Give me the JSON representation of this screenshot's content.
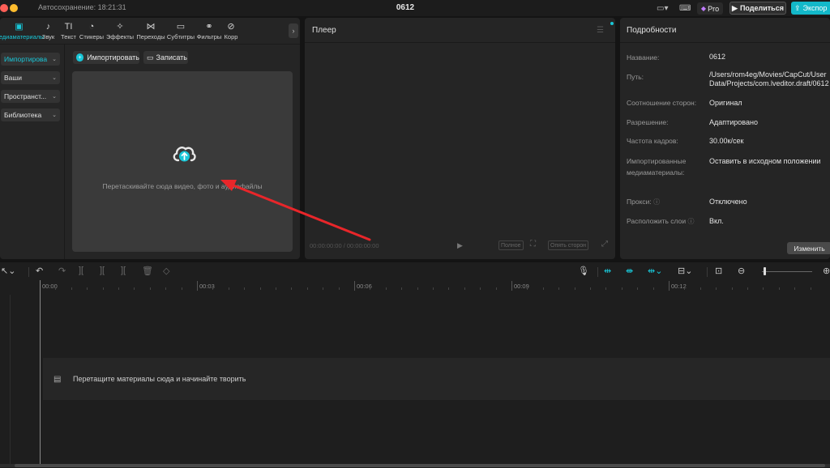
{
  "titlebar": {
    "autosave": "Автосохранение: 18:21:31",
    "project_title": "0612",
    "pro_label": "Pro",
    "share_label": "Поделиться",
    "export_label": "Экспор"
  },
  "media_tabs": [
    {
      "label": "Медиаматериалы",
      "icon": "media-icon",
      "glyph": "▣",
      "active": true
    },
    {
      "label": "Звук",
      "icon": "audio-icon",
      "glyph": "♪",
      "active": false
    },
    {
      "label": "Текст",
      "icon": "text-icon",
      "glyph": "TI",
      "active": false
    },
    {
      "label": "Стикеры",
      "icon": "sticker-icon",
      "glyph": "◔",
      "active": false
    },
    {
      "label": "Эффекты",
      "icon": "effects-icon",
      "glyph": "✧",
      "active": false
    },
    {
      "label": "Переходы",
      "icon": "transitions-icon",
      "glyph": "⋈",
      "active": false
    },
    {
      "label": "Субтитры",
      "icon": "subtitles-icon",
      "glyph": "▭",
      "active": false
    },
    {
      "label": "Фильтры",
      "icon": "filters-icon",
      "glyph": "⚭",
      "active": false
    },
    {
      "label": "Корр",
      "icon": "adjust-icon",
      "glyph": "⊘",
      "active": false
    }
  ],
  "sidebar": {
    "items": [
      {
        "label": "Импортирова",
        "active": true
      },
      {
        "label": "Ваши",
        "active": false
      },
      {
        "label": "Пространст...",
        "active": false
      },
      {
        "label": "Библиотека",
        "active": false
      }
    ]
  },
  "media": {
    "import_label": "Импортировать",
    "record_label": "Записать",
    "drop_hint": "Перетаскивайте сюда видео, фото и аудиофайлы"
  },
  "player": {
    "title": "Плеер",
    "timecode": "00:00:00:00 / 00:00:00:00",
    "fullscreen_label": "Полное",
    "ratio_label": "Опять сторон"
  },
  "details": {
    "title": "Подробности",
    "rows": [
      {
        "label": "Название:",
        "value": "0612"
      },
      {
        "label": "Путь:",
        "value": "/Users/rom4eg/Movies/CapCut/User",
        "value2": "Data/Projects/com.lveditor.draft/0612"
      },
      {
        "label": "Соотношение сторон:",
        "value": "Оригинал"
      },
      {
        "label": "Разрешение:",
        "value": "Адаптировано"
      },
      {
        "label": "Частота кадров:",
        "value": "30.00к/сек"
      },
      {
        "label": "Импортированные",
        "label2": "медиаматериалы:",
        "value": "Оставить в исходном положении"
      },
      {
        "label": "Прокси:",
        "value": "Отключено"
      },
      {
        "label": "Расположить слои",
        "value": "Вкл."
      }
    ],
    "change_label": "Изменить"
  },
  "timeline": {
    "ticks": [
      "00:00",
      "00:03",
      "00:06",
      "00:09",
      "00:12"
    ],
    "hint": "Перетащите материалы сюда и начинайте творить"
  },
  "colors": {
    "accent": "#19c7d8",
    "annotation_arrow": "#e8262a"
  }
}
